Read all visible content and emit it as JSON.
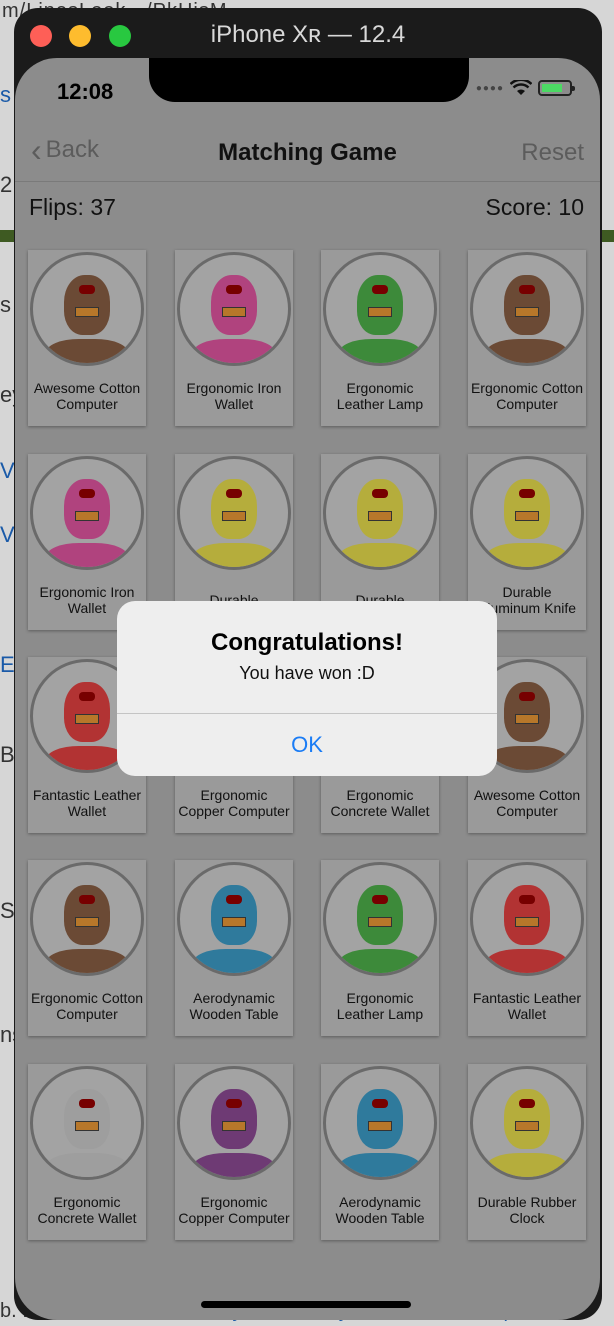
{
  "background": {
    "url_text": "m/LinesLook.../PkHisM...",
    "left_fragments": [
      "s",
      "2",
      "s",
      "ey",
      "V",
      "V",
      "E",
      "B",
      "S",
      "ns"
    ],
    "footer_items": [
      "b. Inc.",
      "Terms",
      "Privacy",
      "Security",
      "Status",
      "Help"
    ]
  },
  "simulator": {
    "window_title": "iPhone Xʀ — 12.4"
  },
  "status_bar": {
    "time": "12:08"
  },
  "navbar": {
    "back_label": "Back",
    "title": "Matching Game",
    "reset_label": "Reset"
  },
  "stats": {
    "flips": "Flips: 37",
    "score": "Score: 10"
  },
  "cards": [
    {
      "caption": "Awesome Cotton Computer",
      "color": "#6b4a35"
    },
    {
      "caption": "Ergonomic Iron Wallet",
      "color": "#b0437e"
    },
    {
      "caption": "Ergonomic Leather Lamp",
      "color": "#3d8a3a"
    },
    {
      "caption": "Ergonomic Cotton Computer",
      "color": "#6b4a35"
    },
    {
      "caption": "Ergonomic Iron Wallet",
      "color": "#b0437e"
    },
    {
      "caption": "Durable",
      "color": "#b5ad3c"
    },
    {
      "caption": "Durable",
      "color": "#b5ad3c"
    },
    {
      "caption": "Durable Aluminum Knife",
      "color": "#b5ad3c"
    },
    {
      "caption": "Fantastic Leather Wallet",
      "color": "#b23333"
    },
    {
      "caption": "Ergonomic Copper Computer",
      "color": "#8c8c8c"
    },
    {
      "caption": "Ergonomic Concrete Wallet",
      "color": "#8c8c8c"
    },
    {
      "caption": "Awesome Cotton Computer",
      "color": "#6b4a35"
    },
    {
      "caption": "Ergonomic Cotton Computer",
      "color": "#6b4a35"
    },
    {
      "caption": "Aerodynamic Wooden Table",
      "color": "#2f7a9c"
    },
    {
      "caption": "Ergonomic Leather Lamp",
      "color": "#3d8a3a"
    },
    {
      "caption": "Fantastic Leather Wallet",
      "color": "#b23333"
    },
    {
      "caption": "Ergonomic Concrete Wallet",
      "color": "#9e9e9e"
    },
    {
      "caption": "Ergonomic Copper Computer",
      "color": "#6e3a74"
    },
    {
      "caption": "Aerodynamic Wooden Table",
      "color": "#2f7a9c"
    },
    {
      "caption": "Durable Rubber Clock",
      "color": "#b5ad3c"
    }
  ],
  "alert": {
    "title": "Congratulations!",
    "message": "You have won :D",
    "ok_label": "OK"
  }
}
